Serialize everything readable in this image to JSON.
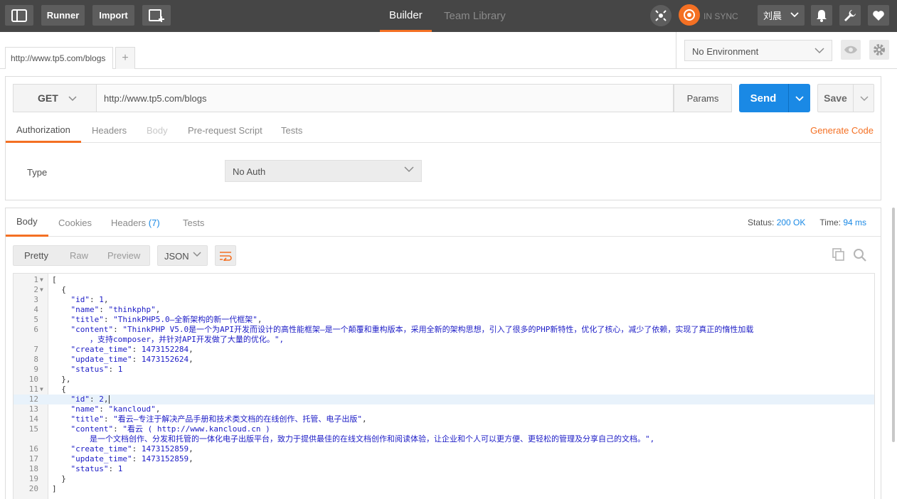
{
  "topbar": {
    "runner_label": "Runner",
    "import_label": "Import",
    "builder_label": "Builder",
    "team_library_label": "Team Library",
    "sync_label": "IN SYNC",
    "user_name": "刘晨"
  },
  "tabs": {
    "request_tab_label": "http://www.tp5.com/blogs",
    "add_tab_label": "+"
  },
  "environment": {
    "selected": "No Environment"
  },
  "request": {
    "method": "GET",
    "url": "http://www.tp5.com/blogs",
    "params_label": "Params",
    "send_label": "Send",
    "save_label": "Save",
    "tabs": [
      "Authorization",
      "Headers",
      "Body",
      "Pre-request Script",
      "Tests"
    ],
    "generate_code_label": "Generate Code",
    "auth_type_label": "Type",
    "auth_type_value": "No Auth"
  },
  "response": {
    "tabs": {
      "body": "Body",
      "cookies": "Cookies",
      "headers": "Headers",
      "headers_count": "(7)",
      "tests": "Tests"
    },
    "status_label": "Status:",
    "status_value": "200 OK",
    "time_label": "Time:",
    "time_value": "94 ms",
    "view_modes": [
      "Pretty",
      "Raw",
      "Preview"
    ],
    "format": "JSON",
    "lines": [
      {
        "n": "1",
        "fold": true,
        "text": "["
      },
      {
        "n": "2",
        "fold": true,
        "text": "  {"
      },
      {
        "n": "3",
        "text": "    \"id\": 1,"
      },
      {
        "n": "4",
        "text": "    \"name\": \"thinkphp\","
      },
      {
        "n": "5",
        "text": "    \"title\": \"ThinkPHP5.0—全新架构的新一代框架\","
      },
      {
        "n": "6",
        "text": "    \"content\": \"ThinkPHP V5.0是一个为API开发而设计的高性能框架—是一个颠覆和重构版本，采用全新的架构思想，引入了很多的PHP新特性，优化了核心，减少了依赖，实现了真正的惰性加载"
      },
      {
        "n": "",
        "text": "        ，支持composer，并针对API开发做了大量的优化。\","
      },
      {
        "n": "7",
        "text": "    \"create_time\": 1473152284,"
      },
      {
        "n": "8",
        "text": "    \"update_time\": 1473152624,"
      },
      {
        "n": "9",
        "text": "    \"status\": 1"
      },
      {
        "n": "10",
        "text": "  },"
      },
      {
        "n": "11",
        "fold": true,
        "text": "  {"
      },
      {
        "n": "12",
        "text": "    \"id\": 2,",
        "highlight": true
      },
      {
        "n": "13",
        "text": "    \"name\": \"kancloud\","
      },
      {
        "n": "14",
        "text": "    \"title\": \"看云—专注于解决产品手册和技术类文档的在线创作、托管、电子出版\","
      },
      {
        "n": "15",
        "text": "    \"content\": \"看云 ( http://www.kancloud.cn )"
      },
      {
        "n": "",
        "text": "        是一个文档创作、分发和托管的一体化电子出版平台，致力于提供最佳的在线文档创作和阅读体验，让企业和个人可以更方便、更轻松的管理及分享自己的文档。\","
      },
      {
        "n": "16",
        "text": "    \"create_time\": 1473152859,"
      },
      {
        "n": "17",
        "text": "    \"update_time\": 1473152859,"
      },
      {
        "n": "18",
        "text": "    \"status\": 1"
      },
      {
        "n": "19",
        "text": "  }"
      },
      {
        "n": "20",
        "text": "]"
      }
    ]
  },
  "colors": {
    "accent": "#f47023",
    "send": "#1a89e5",
    "topbar": "#464646"
  }
}
